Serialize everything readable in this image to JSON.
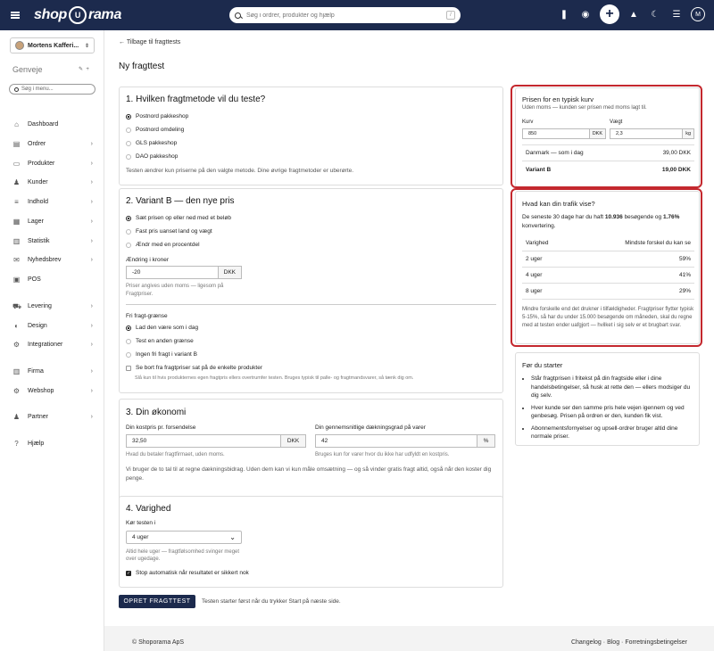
{
  "topbar": {
    "logo_left": "shop",
    "logo_mark": "U",
    "logo_right": "rama",
    "search_placeholder": "Søg i ordrer, produkter og hjælp",
    "search_shortcut": "/",
    "avatar_initial": "M"
  },
  "sidebar": {
    "store_name": "Mortens Kafferi...",
    "shortcuts_title": "Genveje",
    "menu_search_placeholder": "Søg i menu...",
    "items": [
      {
        "label": "Dashboard",
        "icon": "home-icon",
        "arrow": false
      },
      {
        "label": "Ordrer",
        "icon": "orders-icon",
        "arrow": true
      },
      {
        "label": "Produkter",
        "icon": "products-icon",
        "arrow": true
      },
      {
        "label": "Kunder",
        "icon": "customers-icon",
        "arrow": true
      },
      {
        "label": "Indhold",
        "icon": "content-icon",
        "arrow": true
      },
      {
        "label": "Lager",
        "icon": "stock-icon",
        "arrow": true
      },
      {
        "label": "Statistik",
        "icon": "stats-icon",
        "arrow": true
      },
      {
        "label": "Nyhedsbrev",
        "icon": "newsletter-icon",
        "arrow": true
      },
      {
        "label": "POS",
        "icon": "pos-icon",
        "arrow": false
      },
      {
        "label": "Levering",
        "icon": "delivery-icon",
        "arrow": true
      },
      {
        "label": "Design",
        "icon": "design-icon",
        "arrow": true
      },
      {
        "label": "Integrationer",
        "icon": "integrations-icon",
        "arrow": true
      },
      {
        "label": "Firma",
        "icon": "company-icon",
        "arrow": true
      },
      {
        "label": "Webshop",
        "icon": "webshop-icon",
        "arrow": true
      },
      {
        "label": "Partner",
        "icon": "partner-icon",
        "arrow": true
      },
      {
        "label": "Hjælp",
        "icon": "help-icon",
        "arrow": false
      }
    ]
  },
  "page": {
    "back_link": "Tilbage til fragttests",
    "title": "Ny fragttest"
  },
  "section1": {
    "title": "1. Hvilken fragtmetode vil du teste?",
    "options": [
      "Postnord pakkeshop",
      "Postnord omdeling",
      "GLS pakkeshop",
      "DAO pakkeshop"
    ],
    "selected": 0,
    "note": "Testen ændrer kun priserne på den valgte metode. Dine øvrige fragtmetoder er uberørte."
  },
  "section2": {
    "title": "2. Variant B — den nye pris",
    "options": [
      "Sæt prisen op eller ned med et beløb",
      "Fast pris uanset land og vægt",
      "Ændr med en procentdel"
    ],
    "selected": 0,
    "change_label": "Ændring i kroner",
    "change_value": "-20",
    "change_unit": "DKK",
    "change_help": "Priser angives uden moms — ligesom på Fragtpriser.",
    "free_title": "Fri fragt-grænse",
    "free_options": [
      "Lad den være som i dag",
      "Test en anden grænse",
      "Ingen fri fragt i variant B"
    ],
    "free_selected": 0,
    "ignore_label": "Se bort fra fragtpriser sat på de enkelte produkter",
    "ignore_help": "Slå kun til hvis produkternes egen fragtpris ellers overtrumfer testen. Bruges typisk til palle- og fragtmandsvarer, så tænk dig om."
  },
  "section3": {
    "title": "3. Din økonomi",
    "cost_label": "Din kostpris pr. forsendelse",
    "cost_value": "32,50",
    "cost_unit": "DKK",
    "cost_help": "Hvad du betaler fragtfirmaet, uden moms.",
    "margin_label": "Din gennemsnitlige dækningsgrad på varer",
    "margin_value": "42",
    "margin_unit": "%",
    "margin_help": "Bruges kun for varer hvor du ikke har udfyldt en kostpris.",
    "note": "Vi bruger de to tal til at regne dækningsbidrag. Uden dem kan vi kun måle omsætning — og så vinder gratis fragt altid, også når den koster dig penge."
  },
  "section4": {
    "title": "4. Varighed",
    "run_label": "Kør testen i",
    "run_value": "4 uger",
    "run_help": "Altid hele uger — fragtfølsomhed svinger meget over ugedage.",
    "stop_label": "Stop automatisk når resultatet er sikkert nok"
  },
  "actions": {
    "create_label": "OPRET FRAGTTEST",
    "create_note": "Testen starter først når du trykker Start på næste side."
  },
  "price_card": {
    "title": "Prisen for en typisk kurv",
    "subtitle": "Uden moms — kunden ser prisen med moms lagt til.",
    "basket_label": "Kurv",
    "basket_value": "850",
    "basket_unit": "DKK",
    "weight_label": "Vægt",
    "weight_value": "2,3",
    "weight_unit": "kg",
    "row1_label": "Danmark — som i dag",
    "row1_value": "39,00 DKK",
    "row2_label": "Variant B",
    "row2_value": "19,00 DKK"
  },
  "traffic_card": {
    "title": "Hvad kan din trafik vise?",
    "intro_pre": "De seneste 30 dage har du haft ",
    "intro_visitors": "10.936",
    "intro_mid": " besøgende og ",
    "intro_conv": "1.76%",
    "intro_post": " konvertering.",
    "col1": "Varighed",
    "col2": "Mindste forskel du kan se",
    "rows": [
      {
        "duration": "2 uger",
        "diff": "59%"
      },
      {
        "duration": "4 uger",
        "diff": "41%"
      },
      {
        "duration": "8 uger",
        "diff": "29%"
      }
    ],
    "note": "Mindre forskelle end det drukner i tilfældigheder. Fragtpriser flytter typisk 5-15%, så har du under 15.000 besøgende om måneden, skal du regne med at testen ender uafgjort — hvilket i sig selv er et brugbart svar."
  },
  "before_card": {
    "title": "Før du starter",
    "items": [
      "Står fragtprisen i fritekst på din fragtside eller i dine handelsbetingelser, så husk at rette den — ellers modsiger du dig selv.",
      "Hver kunde ser den samme pris hele vejen igennem og ved genbesøg. Prisen på ordren er den, kunden fik vist.",
      "Abonnementsfornyelser og upsell-ordrer bruger altid dine normale priser."
    ]
  },
  "footer": {
    "copyright": "© Shoporama ApS",
    "link1": "Changelog",
    "link2": "Blog",
    "link3": "Forretningsbetingelser",
    "sep": "·"
  },
  "colors": {
    "brand": "#1c2a4d",
    "highlight": "#c4282e"
  }
}
